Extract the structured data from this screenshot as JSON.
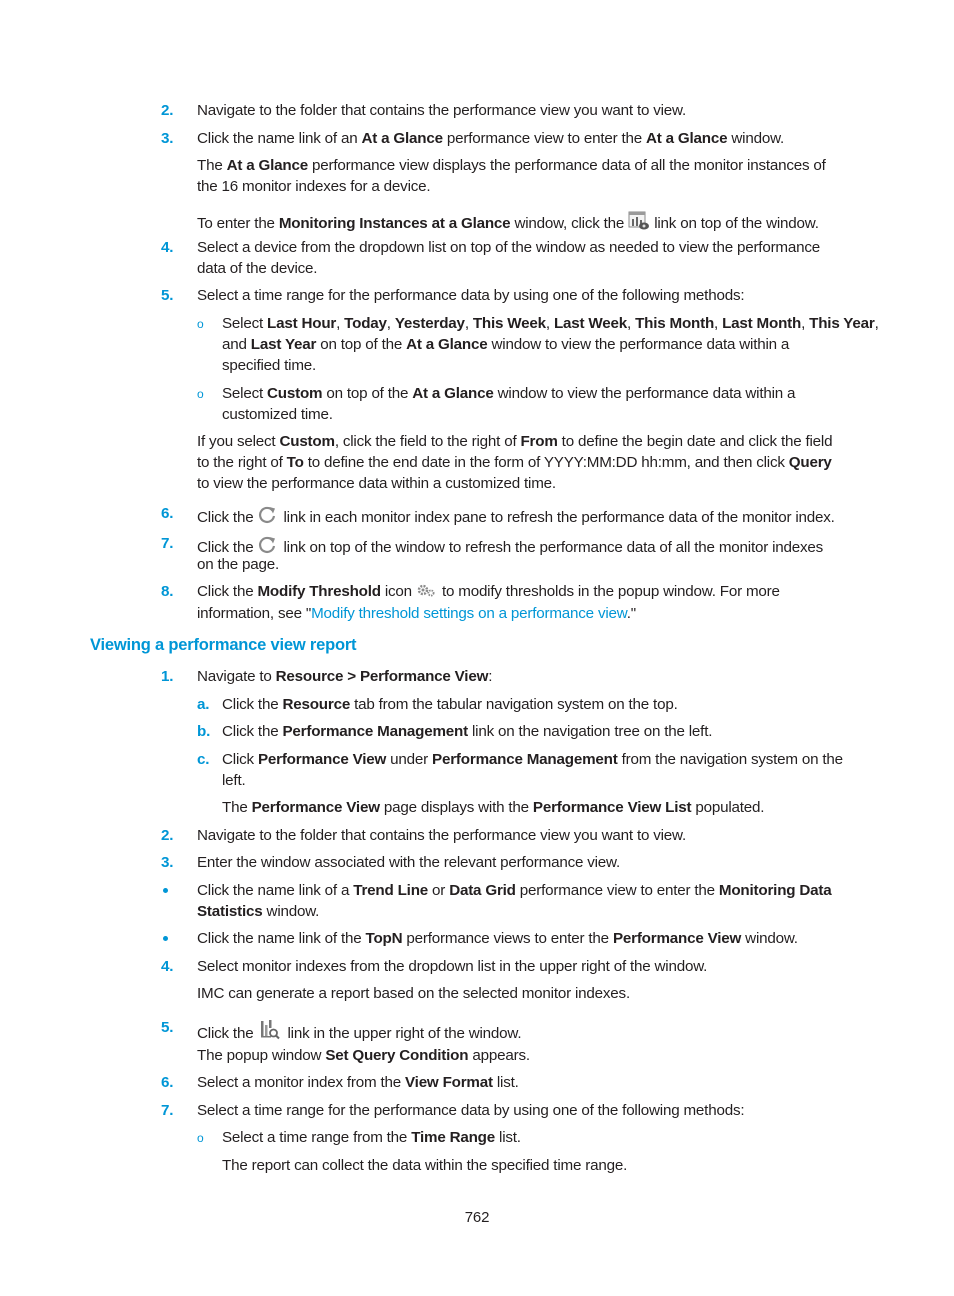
{
  "page_number": "762",
  "section1": {
    "steps": [
      {
        "num": "2.",
        "parts": [
          "Navigate to the folder that contains the performance view you want to view."
        ]
      },
      {
        "num": "3.",
        "parts": [
          "Click the name link of an ",
          "At a Glance",
          " performance view to enter the ",
          "At a Glance",
          " window."
        ]
      }
    ],
    "step3_note1_line1": [
      "The ",
      "At a Glance",
      " performance view displays the performance data of all the monitor instances of"
    ],
    "step3_note1_line2": "the 16 monitor indexes for a device.",
    "step3_note2": [
      "To enter the ",
      "Monitoring Instances at a Glance",
      " window, click the ",
      " link on top of the window."
    ],
    "step3_note2_icon": "monitoring-instances-icon",
    "step4": {
      "num": "4.",
      "line1": "Select a device from the dropdown list on top of the window as needed to view the performance",
      "line2": "data of the device."
    },
    "step5": {
      "num": "5.",
      "text": "Select a time range for the performance data by using one of the following methods:"
    },
    "step5_opt1": {
      "line1": [
        "Select ",
        "Last Hour",
        ", ",
        "Today",
        ", ",
        "Yesterday",
        ", ",
        "This Week",
        ", ",
        "Last Week",
        ", ",
        "This Month",
        ", ",
        "Last Month",
        ", ",
        "This Year",
        ","
      ],
      "line2": [
        "and ",
        "Last Year",
        " on top of the ",
        "At a Glance",
        " window to view the performance data within a"
      ],
      "line3": "specified time."
    },
    "step5_opt2": {
      "line1": [
        "Select ",
        "Custom",
        " on top of the ",
        "At a Glance",
        " window to view the performance data within a"
      ],
      "line2": "customized time."
    },
    "step5_custom": {
      "line1": [
        "If you select ",
        "Custom",
        ", click the field to the right of ",
        "From",
        " to define the begin date and click the field"
      ],
      "line2": [
        "to the right of ",
        "To",
        " to define the end date in the form of YYYY:MM:DD hh:mm, and then click ",
        "Query"
      ],
      "line3": "to view the performance data within a customized time."
    },
    "step6": {
      "num": "6.",
      "parts": [
        "Click the ",
        " link in each monitor index pane to refresh the performance data of the monitor index."
      ],
      "icon": "refresh-icon"
    },
    "step7": {
      "num": "7.",
      "parts": [
        "Click the ",
        " link on top of the window to refresh the performance data of all the monitor indexes"
      ],
      "line2": "on the page.",
      "icon": "refresh-icon"
    },
    "step8": {
      "num": "8.",
      "line1": [
        "Click the ",
        "Modify Threshold",
        " icon ",
        " to modify thresholds in the popup window. For more"
      ],
      "line2_pre": "information, see \"",
      "line2_link": "Modify threshold settings on a performance view",
      "line2_post": ".\"",
      "icon": "modify-threshold-icon"
    }
  },
  "section2": {
    "heading": "Viewing a performance view report",
    "step1": {
      "num": "1.",
      "parts": [
        "Navigate to ",
        "Resource > Performance View",
        ":"
      ]
    },
    "substeps": [
      {
        "letter": "a.",
        "parts": [
          "Click the ",
          "Resource",
          " tab from the tabular navigation system on the top."
        ]
      },
      {
        "letter": "b.",
        "parts": [
          "Click the ",
          "Performance Management",
          " link on the navigation tree on the left."
        ]
      },
      {
        "letter": "c.",
        "parts": [
          "Click ",
          "Performance View",
          " under ",
          "Performance Management",
          " from the navigation system on the"
        ],
        "line2": "left."
      }
    ],
    "substep_c_note": [
      "The ",
      "Performance View",
      " page displays with the ",
      "Performance View List",
      " populated."
    ],
    "step2": {
      "num": "2.",
      "text": "Navigate to the folder that contains the performance view you want to view."
    },
    "step3": {
      "num": "3.",
      "text": "Enter the window associated with the relevant performance view."
    },
    "bullet1": {
      "line1": [
        "Click the name link of a ",
        "Trend Line",
        " or ",
        "Data Grid",
        " performance view to enter the ",
        "Monitoring Data"
      ],
      "line2": [
        "Statistics",
        " window."
      ]
    },
    "bullet2": [
      "Click the name link of the ",
      "TopN",
      " performance views to enter the ",
      "Performance View",
      " window."
    ],
    "step4": {
      "num": "4.",
      "text": "Select monitor indexes from the dropdown list in the upper right of the window."
    },
    "step4_note": "IMC can generate a report based on the selected monitor indexes.",
    "step5": {
      "num": "5.",
      "parts": [
        "Click the ",
        " link in the upper right of the window."
      ],
      "icon": "query-report-icon"
    },
    "step5_note": [
      "The popup window ",
      "Set Query Condition",
      " appears."
    ],
    "step6": {
      "num": "6.",
      "parts": [
        "Select a monitor index from the ",
        "View Format",
        " list."
      ]
    },
    "step7": {
      "num": "7.",
      "text": "Select a time range for the performance data by using one of the following methods:"
    },
    "step7_opt1": [
      "Select a time range from the ",
      "Time Range",
      " list."
    ],
    "step7_opt1_note": "The report can collect the data within the specified time range."
  }
}
